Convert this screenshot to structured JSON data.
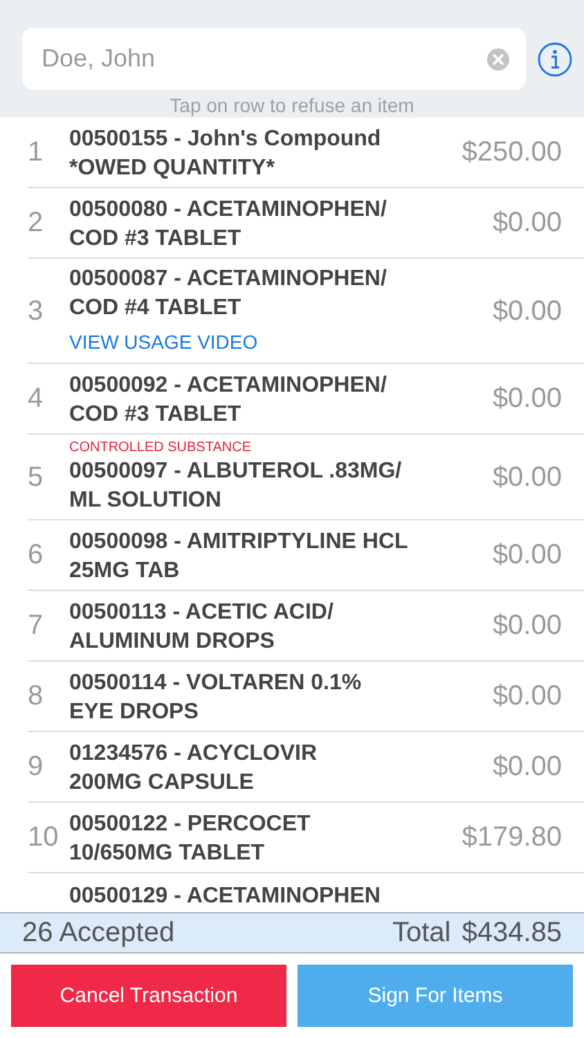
{
  "search": {
    "value": "Doe, John"
  },
  "hint": "Tap on row to refuse an item",
  "items": [
    {
      "number": "1",
      "lines": [
        "00500155 - John's Compound",
        "*OWED QUANTITY*"
      ],
      "price": "$250.00"
    },
    {
      "number": "2",
      "lines": [
        "00500080 - ACETAMINOPHEN/",
        "COD #3 TABLET"
      ],
      "price": "$0.00"
    },
    {
      "number": "3",
      "lines": [
        "00500087 - ACETAMINOPHEN/",
        "COD #4 TABLET"
      ],
      "price": "$0.00",
      "link": "VIEW USAGE VIDEO"
    },
    {
      "number": "4",
      "lines": [
        "00500092 - ACETAMINOPHEN/",
        "COD #3 TABLET"
      ],
      "price": "$0.00"
    },
    {
      "number": "5",
      "lines": [
        "00500097 - ALBUTEROL .83MG/",
        "ML SOLUTION"
      ],
      "price": "$0.00",
      "warning": "CONTROLLED SUBSTANCE"
    },
    {
      "number": "6",
      "lines": [
        "00500098 - AMITRIPTYLINE HCL",
        "25MG TAB"
      ],
      "price": "$0.00"
    },
    {
      "number": "7",
      "lines": [
        "00500113 - ACETIC ACID/",
        "ALUMINUM DROPS"
      ],
      "price": "$0.00"
    },
    {
      "number": "8",
      "lines": [
        "00500114 - VOLTAREN 0.1%",
        "EYE DROPS"
      ],
      "price": "$0.00"
    },
    {
      "number": "9",
      "lines": [
        "01234576 - ACYCLOVIR",
        "200MG CAPSULE"
      ],
      "price": "$0.00"
    },
    {
      "number": "10",
      "lines": [
        "00500122 - PERCOCET",
        "10/650MG TABLET"
      ],
      "price": "$179.80"
    },
    {
      "lines": [
        "00500129 - ACETAMINOPHEN"
      ]
    }
  ],
  "summary": {
    "accepted": "26 Accepted",
    "total_label": "Total",
    "total": "$434.85"
  },
  "buttons": [
    {
      "label": "Cancel Transaction",
      "kind": "danger"
    },
    {
      "label": "Sign For Items",
      "kind": "primary"
    }
  ]
}
